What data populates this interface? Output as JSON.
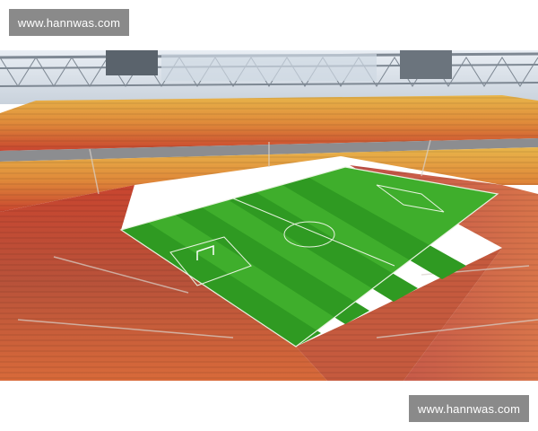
{
  "watermarks": {
    "top": "www.hannwas.com",
    "bottom": "www.hannwas.com"
  },
  "photo": {
    "subject": "stadium",
    "colors": {
      "pitch_light": "#3fae2c",
      "pitch_dark": "#2f9a22",
      "seat_red": "#c8452f",
      "seat_orange": "#e08a3a",
      "seat_yellow": "#e8b54a",
      "roof_steel": "#9aa3ad",
      "sky": "#dfe6ee"
    }
  }
}
